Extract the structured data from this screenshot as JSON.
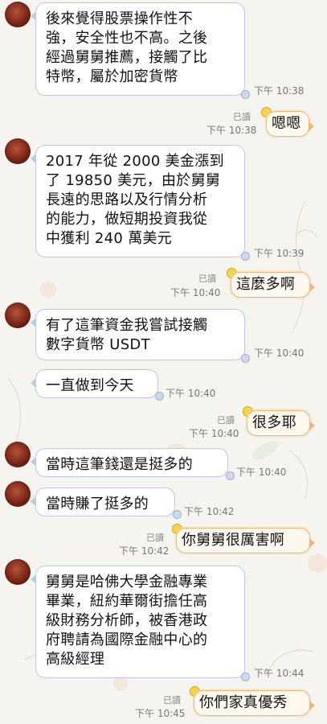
{
  "messages": [
    {
      "side": "in",
      "text": "後來覺得股票操作性不\n強，安全性也不高。之後\n經過舅舅推薦，接觸了比\n特幣，屬於加密貨幣",
      "time": "下午 10:38"
    },
    {
      "side": "out",
      "text": "嗯嗯",
      "read": "已讀",
      "time": "下午 10:38"
    },
    {
      "side": "in",
      "text": "2017 年從 2000 美金漲到\n了 19850 美元，由於舅舅\n長遠的思路以及行情分析\n的能力，做短期投資我從\n中獲利 240 萬美元",
      "time": "下午 10:39"
    },
    {
      "side": "out",
      "text": "這麼多啊",
      "read": "已讀",
      "time": "下午 10:40"
    },
    {
      "side": "in",
      "text": "有了這筆資金我嘗試接觸\n數字貨幣 USDT",
      "time": "下午 10:40"
    },
    {
      "side": "in",
      "text": "一直做到今天",
      "time": "下午 10:40"
    },
    {
      "side": "out",
      "text": "很多耶",
      "read": "已讀",
      "time": "下午 10:40"
    },
    {
      "side": "in",
      "text": "當時這筆錢還是挺多的",
      "time": "下午 10:40"
    },
    {
      "side": "in",
      "text": "當時賺了挺多的",
      "time": "下午 10:42"
    },
    {
      "side": "out",
      "text": "你舅舅很厲害啊",
      "read": "已讀",
      "time": "下午 10:42"
    },
    {
      "side": "in",
      "text": "舅舅是哈佛大學金融專業\n畢業，紐約華爾街擔任高\n級財務分析師，被香港政\n府聘請為國際金融中心的\n高級經理",
      "time": "下午 10:44"
    },
    {
      "side": "out",
      "text": "你們家真優秀",
      "read": "已讀",
      "time": "下午 10:45"
    }
  ],
  "colors": {
    "in_border": "#b9c9e6",
    "out_border": "#e8b87a",
    "background": "#f6f4ef"
  }
}
